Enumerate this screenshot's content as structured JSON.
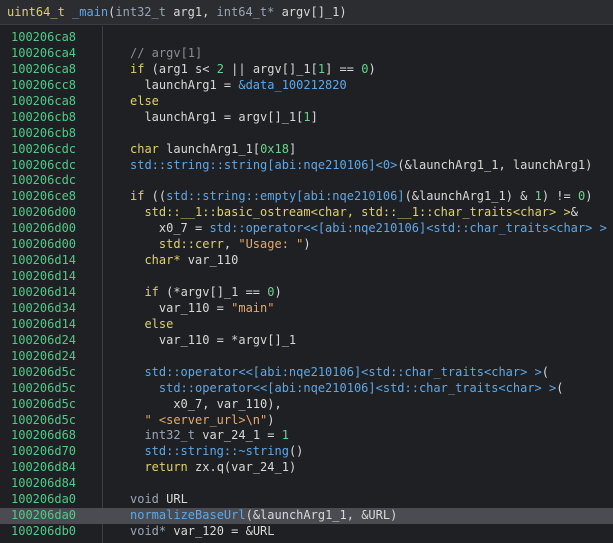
{
  "signature": [
    {
      "t": "uint64_t ",
      "c": "type"
    },
    {
      "t": "_main",
      "c": "fn"
    },
    {
      "t": "(",
      "c": "p"
    },
    {
      "t": "int32_t ",
      "c": "tpl"
    },
    {
      "t": "arg1, ",
      "c": "id"
    },
    {
      "t": "int64_t* ",
      "c": "tpl"
    },
    {
      "t": "argv[]_1)",
      "c": "id"
    }
  ],
  "lines": [
    {
      "addr": "100206ca8",
      "indent": 0,
      "tokens": []
    },
    {
      "addr": "100206ca4",
      "indent": 0,
      "tokens": [
        {
          "t": "// argv[1]",
          "c": "cmt"
        }
      ]
    },
    {
      "addr": "100206ca8",
      "indent": 0,
      "tokens": [
        {
          "t": "if",
          "c": "kw"
        },
        {
          "t": " (arg1 s< ",
          "c": "id"
        },
        {
          "t": "2",
          "c": "num"
        },
        {
          "t": " || argv[]_1[",
          "c": "id"
        },
        {
          "t": "1",
          "c": "num"
        },
        {
          "t": "] == ",
          "c": "id"
        },
        {
          "t": "0",
          "c": "num"
        },
        {
          "t": ")",
          "c": "id"
        }
      ]
    },
    {
      "addr": "100206cc8",
      "indent": 2,
      "tokens": [
        {
          "t": "launchArg1 = ",
          "c": "id"
        },
        {
          "t": "&data_100212820",
          "c": "fn"
        }
      ]
    },
    {
      "addr": "100206ca8",
      "indent": 0,
      "tokens": [
        {
          "t": "else",
          "c": "kw"
        }
      ]
    },
    {
      "addr": "100206cb8",
      "indent": 2,
      "tokens": [
        {
          "t": "launchArg1 = argv[]_1[",
          "c": "id"
        },
        {
          "t": "1",
          "c": "num"
        },
        {
          "t": "]",
          "c": "id"
        }
      ]
    },
    {
      "addr": "100206cb8",
      "indent": 0,
      "tokens": []
    },
    {
      "addr": "100206cdc",
      "indent": 0,
      "tokens": [
        {
          "t": "char",
          "c": "type"
        },
        {
          "t": " launchArg1_1[",
          "c": "id"
        },
        {
          "t": "0x18",
          "c": "num"
        },
        {
          "t": "]",
          "c": "id"
        }
      ]
    },
    {
      "addr": "100206cdc",
      "indent": 0,
      "tokens": [
        {
          "t": "std::string::string[abi:nqe210106]<0>",
          "c": "fn"
        },
        {
          "t": "(&launchArg1_1, launchArg1)",
          "c": "id"
        }
      ]
    },
    {
      "addr": "100206cdc",
      "indent": 0,
      "tokens": []
    },
    {
      "addr": "100206ce8",
      "indent": 0,
      "tokens": [
        {
          "t": "if",
          "c": "kw"
        },
        {
          "t": " ((",
          "c": "id"
        },
        {
          "t": "std::string::empty[abi:nqe210106]",
          "c": "fn"
        },
        {
          "t": "(&launchArg1_1) & ",
          "c": "id"
        },
        {
          "t": "1",
          "c": "num"
        },
        {
          "t": ") != ",
          "c": "id"
        },
        {
          "t": "0",
          "c": "num"
        },
        {
          "t": ")",
          "c": "id"
        }
      ]
    },
    {
      "addr": "100206d00",
      "indent": 2,
      "tokens": [
        {
          "t": "std::__1::basic_ostream<char, std::__1::char_traits<char> >",
          "c": "type"
        },
        {
          "t": "&",
          "c": "id"
        }
      ]
    },
    {
      "addr": "100206d00",
      "indent": 4,
      "tokens": [
        {
          "t": "x0_7 = ",
          "c": "id"
        },
        {
          "t": "std::operator<<[abi:nqe210106]<std::char_traits<char> >",
          "c": "fn"
        }
      ]
    },
    {
      "addr": "100206d00",
      "indent": 4,
      "tokens": [
        {
          "t": "std::cerr",
          "c": "type"
        },
        {
          "t": ", ",
          "c": "id"
        },
        {
          "t": "\"Usage: \"",
          "c": "str"
        },
        {
          "t": ")",
          "c": "id"
        }
      ]
    },
    {
      "addr": "100206d14",
      "indent": 2,
      "tokens": [
        {
          "t": "char*",
          "c": "type"
        },
        {
          "t": " var_110",
          "c": "id"
        }
      ]
    },
    {
      "addr": "100206d14",
      "indent": 2,
      "tokens": []
    },
    {
      "addr": "100206d14",
      "indent": 2,
      "tokens": [
        {
          "t": "if",
          "c": "kw"
        },
        {
          "t": " (*argv[]_1 == ",
          "c": "id"
        },
        {
          "t": "0",
          "c": "num"
        },
        {
          "t": ")",
          "c": "id"
        }
      ]
    },
    {
      "addr": "100206d34",
      "indent": 4,
      "tokens": [
        {
          "t": "var_110 = ",
          "c": "id"
        },
        {
          "t": "\"main\"",
          "c": "str"
        }
      ]
    },
    {
      "addr": "100206d14",
      "indent": 2,
      "tokens": [
        {
          "t": "else",
          "c": "kw"
        }
      ]
    },
    {
      "addr": "100206d24",
      "indent": 4,
      "tokens": [
        {
          "t": "var_110 = *argv[]_1",
          "c": "id"
        }
      ]
    },
    {
      "addr": "100206d24",
      "indent": 2,
      "tokens": []
    },
    {
      "addr": "100206d5c",
      "indent": 2,
      "tokens": [
        {
          "t": "std::operator<<[abi:nqe210106]<std::char_traits<char> >",
          "c": "fn"
        },
        {
          "t": "(",
          "c": "id"
        }
      ]
    },
    {
      "addr": "100206d5c",
      "indent": 4,
      "tokens": [
        {
          "t": "std::operator<<[abi:nqe210106]<std::char_traits<char> >",
          "c": "fn"
        },
        {
          "t": "(",
          "c": "id"
        }
      ]
    },
    {
      "addr": "100206d5c",
      "indent": 6,
      "tokens": [
        {
          "t": "x0_7, var_110),",
          "c": "id"
        }
      ]
    },
    {
      "addr": "100206d5c",
      "indent": 2,
      "tokens": [
        {
          "t": "\" <server_url>\\n\"",
          "c": "str"
        },
        {
          "t": ")",
          "c": "id"
        }
      ]
    },
    {
      "addr": "100206d68",
      "indent": 2,
      "tokens": [
        {
          "t": "int32_t",
          "c": "tpl"
        },
        {
          "t": " var_24_1 = ",
          "c": "id"
        },
        {
          "t": "1",
          "c": "num"
        }
      ]
    },
    {
      "addr": "100206d70",
      "indent": 2,
      "tokens": [
        {
          "t": "std::string::~string",
          "c": "fn"
        },
        {
          "t": "()",
          "c": "id"
        }
      ]
    },
    {
      "addr": "100206d84",
      "indent": 2,
      "tokens": [
        {
          "t": "return",
          "c": "kw"
        },
        {
          "t": " zx.q(var_24_1)",
          "c": "id"
        }
      ]
    },
    {
      "addr": "100206d84",
      "indent": 0,
      "tokens": []
    },
    {
      "addr": "100206da0",
      "indent": 0,
      "tokens": [
        {
          "t": "void",
          "c": "tpl"
        },
        {
          "t": " URL",
          "c": "id"
        }
      ]
    },
    {
      "addr": "100206da0",
      "indent": 0,
      "highlight": true,
      "tokens": [
        {
          "t": "normalizeBaseUrl",
          "c": "fn"
        },
        {
          "t": "(&launchArg1_1, &URL)",
          "c": "id"
        }
      ]
    },
    {
      "addr": "100206db0",
      "indent": 0,
      "tokens": [
        {
          "t": "void*",
          "c": "tpl"
        },
        {
          "t": " var_120 = &URL",
          "c": "id"
        }
      ]
    }
  ]
}
